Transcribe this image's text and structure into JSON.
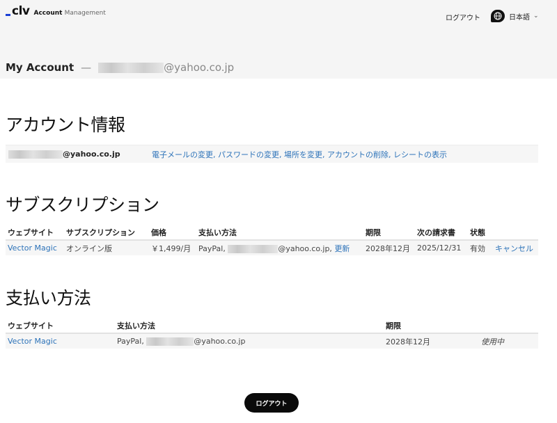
{
  "header": {
    "logo_mark": "clv",
    "logo_text_bold": "Account",
    "logo_text_light": "Management",
    "logout_label": "ログアウト",
    "language_label": "日本語"
  },
  "account": {
    "title": "My Account",
    "separator": "—",
    "email_suffix": "@yahoo.co.jp"
  },
  "account_info": {
    "heading": "アカウント情報",
    "email_suffix": "@yahoo.co.jp",
    "links": [
      "電子メールの変更",
      "パスワードの変更",
      "場所を変更",
      "アカウントの削除",
      "レシートの表示"
    ],
    "link_separator": ", "
  },
  "subscriptions": {
    "heading": "サブスクリプション",
    "columns": [
      "ウェブサイト",
      "サブスクリプション",
      "価格",
      "支払い方法",
      "期限",
      "次の請求書",
      "状態",
      ""
    ],
    "rows": [
      {
        "website": "Vector Magic",
        "plan": "オンライン版",
        "price": "￥1,499/月",
        "payment_prefix": "PayPal,",
        "payment_suffix": "@yahoo.co.jp,",
        "update_label": "更新",
        "expiry": "2028年12月",
        "next_invoice": "2025/12/31",
        "status": "有効",
        "cancel_label": "キャンセル"
      }
    ]
  },
  "payment_methods": {
    "heading": "支払い方法",
    "columns": [
      "ウェブサイト",
      "支払い方法",
      "期限",
      ""
    ],
    "rows": [
      {
        "website": "Vector Magic",
        "payment_prefix": "PayPal,",
        "payment_suffix": "@yahoo.co.jp",
        "expiry": "2028年12月",
        "in_use": "使用中"
      }
    ]
  },
  "footer": {
    "logout_button": "ログアウト"
  },
  "colors": {
    "link": "#2d73b9",
    "logo_accent": "#1a3fd6",
    "button_bg": "#0a0a0a"
  }
}
